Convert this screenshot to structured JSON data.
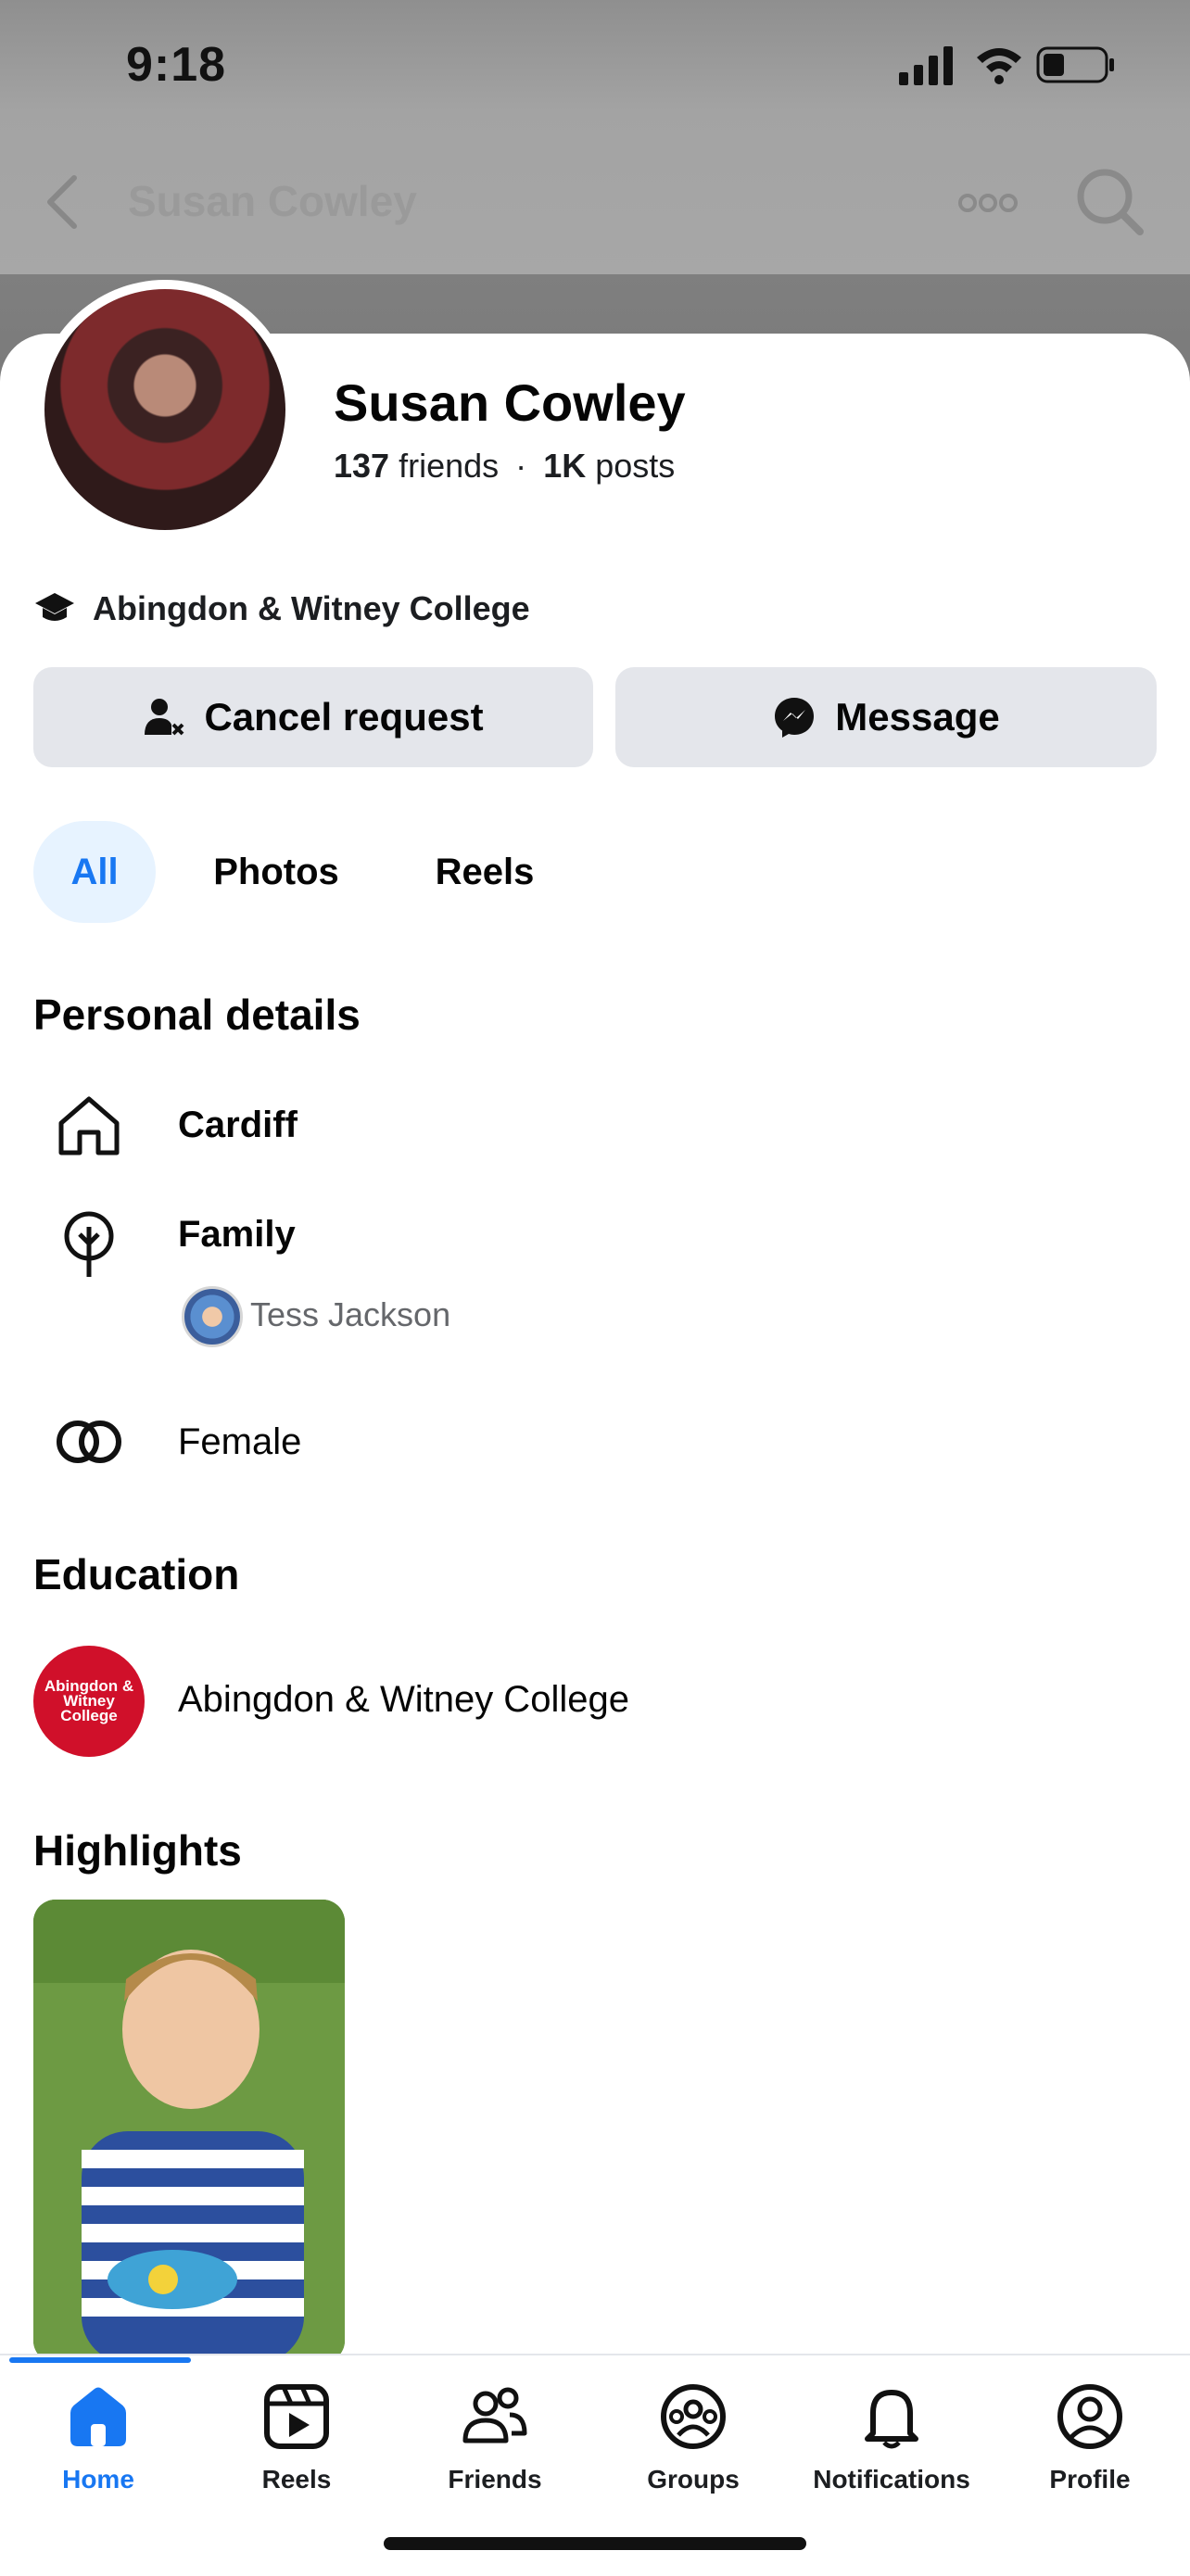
{
  "status_bar": {
    "time": "9:18"
  },
  "nav": {
    "title": "Susan Cowley"
  },
  "profile": {
    "name": "Susan Cowley",
    "friends_count": "137",
    "friends_label": "friends",
    "separator": "·",
    "posts_count": "1K",
    "posts_label": "posts",
    "education_line": "Abingdon & Witney College"
  },
  "actions": {
    "cancel_request": "Cancel request",
    "message": "Message"
  },
  "filters": {
    "all": "All",
    "photos": "Photos",
    "reels": "Reels"
  },
  "personal_details": {
    "heading": "Personal details",
    "city": "Cardiff",
    "family_label": "Family",
    "family_member": "Tess Jackson",
    "gender": "Female"
  },
  "education": {
    "heading": "Education",
    "school": "Abingdon & Witney College",
    "logo_text": "Abingdon & Witney College"
  },
  "highlights": {
    "heading": "Highlights"
  },
  "tabbar": {
    "home": "Home",
    "reels": "Reels",
    "friends": "Friends",
    "groups": "Groups",
    "notifications": "Notifications",
    "profile": "Profile"
  },
  "colors": {
    "accent": "#1877f2",
    "button_bg": "#e4e6eb",
    "pill_active_bg": "#e7f3ff",
    "college_red": "#d0102a"
  }
}
